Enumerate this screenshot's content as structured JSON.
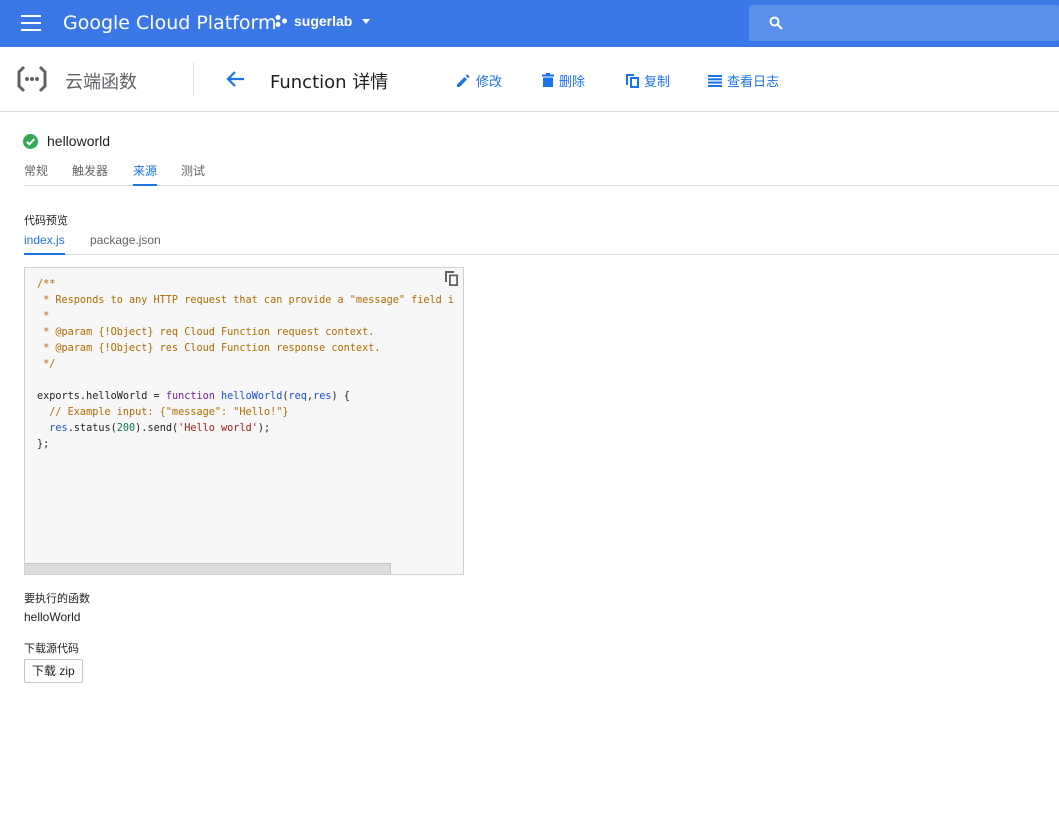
{
  "appbar": {
    "brand": "Google Cloud Platform",
    "project": "sugerlab",
    "bg_color": "#3b78e7"
  },
  "subheader": {
    "product_name": "云端函数",
    "page_title": "Function 详情",
    "actions": {
      "edit": "修改",
      "delete": "删除",
      "copy": "复制",
      "logs": "查看日志"
    }
  },
  "function": {
    "name": "helloworld",
    "status_color": "#34a853"
  },
  "tabs": [
    "常规",
    "触发器",
    "来源",
    "测试"
  ],
  "active_tab": "来源",
  "source": {
    "code_preview_label": "代码预览",
    "files": [
      "index.js",
      "package.json"
    ],
    "active_file": "index.js",
    "code_lines": [
      "/**",
      " * Responds to any HTTP request that can provide a \"message\" field i",
      " *",
      " * @param {!Object} req Cloud Function request context.",
      " * @param {!Object} res Cloud Function response context.",
      " */",
      "",
      "exports.helloWorld = function helloWorld(req,res) {",
      "  // Example input: {\"message\": \"Hello!\"}",
      "  res.status(200).send('Hello world');",
      "};"
    ]
  },
  "entry_point": {
    "label": "要执行的函数",
    "value": "helloWorld"
  },
  "download": {
    "label": "下载源代码",
    "button": "下载 zip"
  }
}
